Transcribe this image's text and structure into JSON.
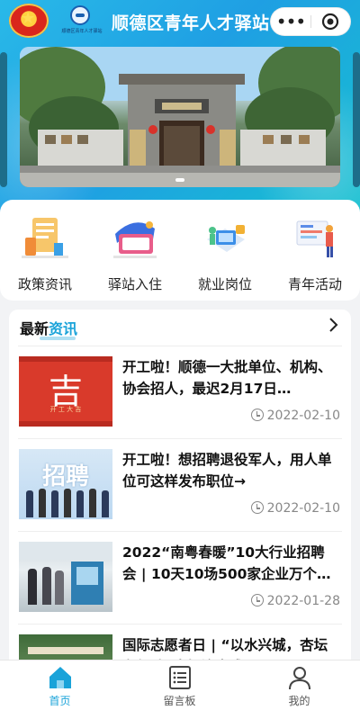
{
  "app": {
    "title": "顺德区青年人才驿站",
    "logo2_text": "顺德区青年人才驿站"
  },
  "capsule": {
    "more_icon": "more-dots-icon",
    "close_icon": "record-target-icon"
  },
  "quick_menu": [
    {
      "label": "政策资讯",
      "icon": "policy-news-icon"
    },
    {
      "label": "驿站入住",
      "icon": "station-checkin-icon"
    },
    {
      "label": "就业岗位",
      "icon": "job-positions-icon"
    },
    {
      "label": "青年活动",
      "icon": "youth-activities-icon"
    }
  ],
  "news": {
    "heading_main": "最新",
    "heading_accent": "资讯",
    "items": [
      {
        "title": "开工啦！顺德一大批单位、机构、协会招人，最迟2月17日…",
        "date": "2022-02-10",
        "thumb_text": "吉",
        "thumb_sub": "开 工 大 吉"
      },
      {
        "title": "开工啦！想招聘退役军人，用人单位可这样发布职位→",
        "date": "2022-02-10",
        "thumb_text": "招聘"
      },
      {
        "title": "2022“南粤春暖”10大行业招聘会 | 10天10场500家企业万个…",
        "date": "2022-01-28"
      },
      {
        "title": "国际志愿者日 | “以水兴城，杏坛在行动”杏坛治水成果展",
        "date": ""
      }
    ]
  },
  "tabbar": [
    {
      "label": "首页",
      "icon": "home-icon",
      "active": true
    },
    {
      "label": "留言板",
      "icon": "message-board-icon",
      "active": false
    },
    {
      "label": "我的",
      "icon": "profile-icon",
      "active": false
    }
  ],
  "colors": {
    "accent": "#1aa3d9",
    "header_gradient_start": "#29b9e8",
    "header_gradient_end": "#16c2cf"
  }
}
